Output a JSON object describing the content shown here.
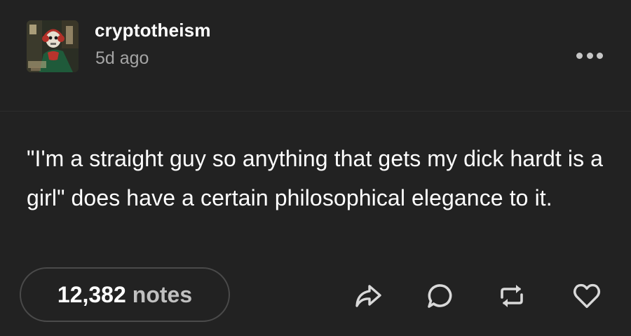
{
  "post": {
    "author": "cryptotheism",
    "time_ago": "5d ago",
    "body": "\"I'm a straight guy so anything that gets my dick hardt is a girl\" does have a certain philosophical elegance to it."
  },
  "footer": {
    "notes_count": "12,382",
    "notes_label": "notes",
    "actions": [
      "share-icon",
      "reply-icon",
      "reblog-icon",
      "like-icon"
    ]
  },
  "header_icons": [
    "more-icon"
  ],
  "colors": {
    "background": "#222222",
    "text_primary": "#ffffff",
    "text_secondary": "#a5a5a5",
    "icon": "#d9d9d9",
    "pill_border": "#4a4a4a"
  }
}
